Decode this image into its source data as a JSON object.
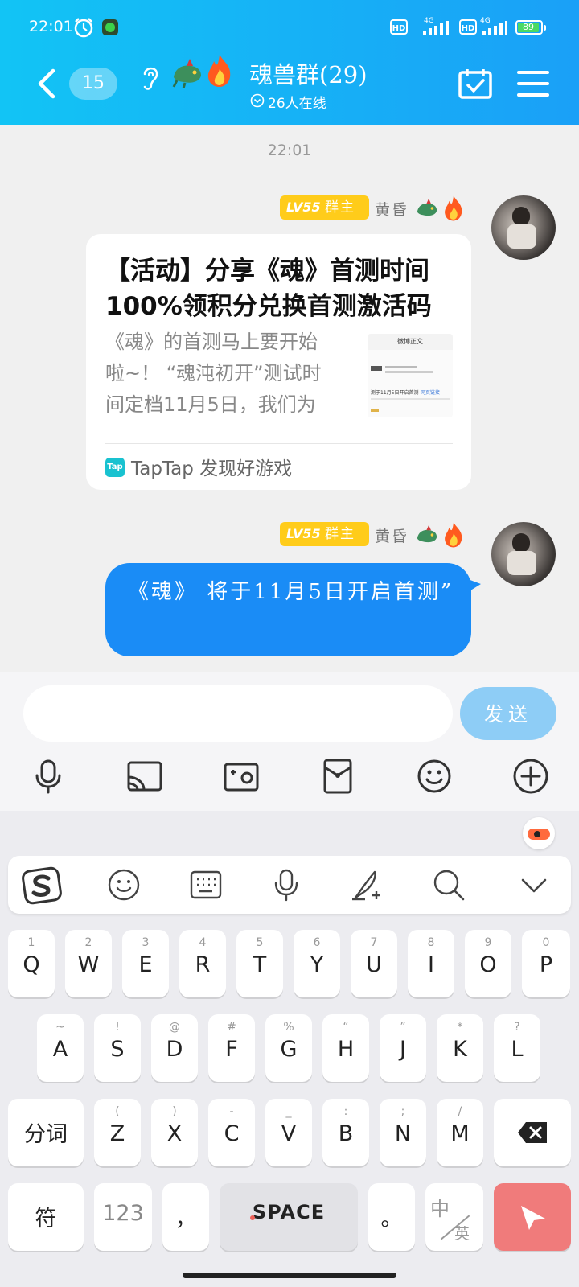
{
  "status_bar": {
    "time": "22:01",
    "battery": "89",
    "network_badges": [
      "HD",
      "HD"
    ],
    "signal_labels": [
      "4G",
      "4G"
    ]
  },
  "header": {
    "unread_count": "15",
    "group_name": "魂兽群(29)",
    "online_text": "26人在线"
  },
  "chat": {
    "timestamp": "22:01",
    "messages": [
      {
        "level": "LV55",
        "role": "群主",
        "sender": "黄昏",
        "type": "link-card",
        "card_title": "【活动】分享《魂》首测时间 100%领积分兑换首测激活码",
        "card_desc": "《魂》的首测马上要开始啦~！ “魂沌初开”测试时间定档11月5日，我们为大家准备了",
        "thumb_header": "微博正文",
        "thumb_text": "测于11月5日开启首测",
        "thumb_link": "网页链接",
        "source_icon": "Tap",
        "source": "TapTap 发现好游戏"
      },
      {
        "level": "LV55",
        "role": "群主",
        "sender": "黄昏",
        "type": "text",
        "text": "《魂》 将于11月5日开启首测”"
      }
    ]
  },
  "input_bar": {
    "placeholder": "",
    "send_label": "发送",
    "tools": [
      "microphone-icon",
      "screen-cast-icon",
      "photo-icon",
      "red-packet-icon",
      "emoji-icon",
      "plus-icon"
    ]
  },
  "keyboard": {
    "toolbar": [
      "sogou-logo-icon",
      "emoji-icon",
      "keyboard-icon",
      "voice-icon",
      "handwriting-icon",
      "search-icon",
      "collapse-icon"
    ],
    "row1": [
      {
        "sub": "1",
        "key": "Q"
      },
      {
        "sub": "2",
        "key": "W"
      },
      {
        "sub": "3",
        "key": "E"
      },
      {
        "sub": "4",
        "key": "R"
      },
      {
        "sub": "5",
        "key": "T"
      },
      {
        "sub": "6",
        "key": "Y"
      },
      {
        "sub": "7",
        "key": "U"
      },
      {
        "sub": "8",
        "key": "I"
      },
      {
        "sub": "9",
        "key": "O"
      },
      {
        "sub": "0",
        "key": "P"
      }
    ],
    "row2": [
      {
        "sub": "~",
        "key": "A"
      },
      {
        "sub": "!",
        "key": "S"
      },
      {
        "sub": "@",
        "key": "D"
      },
      {
        "sub": "#",
        "key": "F"
      },
      {
        "sub": "%",
        "key": "G"
      },
      {
        "sub": "“",
        "key": "H"
      },
      {
        "sub": "”",
        "key": "J"
      },
      {
        "sub": "*",
        "key": "K"
      },
      {
        "sub": "?",
        "key": "L"
      }
    ],
    "row3": [
      {
        "sub": "(",
        "key": "Z"
      },
      {
        "sub": ")",
        "key": "X"
      },
      {
        "sub": "-",
        "key": "C"
      },
      {
        "sub": "_",
        "key": "V"
      },
      {
        "sub": ":",
        "key": "B"
      },
      {
        "sub": ";",
        "key": "N"
      },
      {
        "sub": "/",
        "key": "M"
      }
    ],
    "segment_label": "分词",
    "symbol_label": "符",
    "numeric_label": "123",
    "comma_label": "，",
    "space_label": "SPACE",
    "period_label": "。",
    "lang_top": "中",
    "lang_bottom": "英"
  },
  "colors": {
    "header_start": "#12c4f5",
    "header_end": "#1aa0f7",
    "bubble": "#1a8cf6",
    "send": "#8ecdf6",
    "level_badge": "#ffcc1a",
    "enter_key": "#f07b7b"
  }
}
